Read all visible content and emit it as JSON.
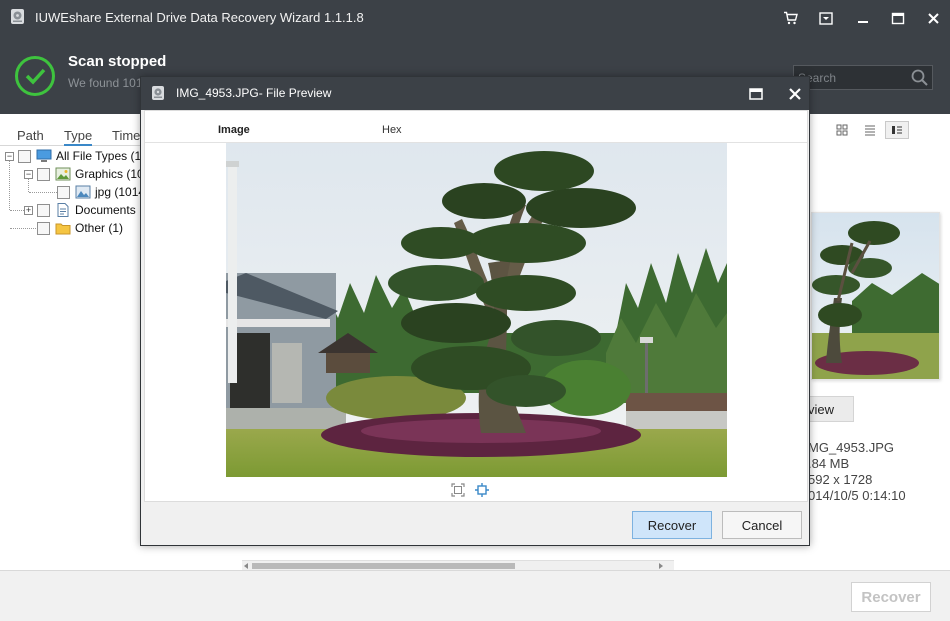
{
  "window": {
    "title": "IUWEshare External Drive Data Recovery Wizard 1.1.1.8",
    "icons": [
      "app-drive-icon",
      "cart-icon",
      "menu-dropdown-icon",
      "minimize-icon",
      "maximize-icon",
      "close-icon"
    ]
  },
  "status": {
    "title": "Scan stopped",
    "subtitle": "We found 101",
    "success_color": "#3ec33e"
  },
  "search": {
    "placeholder": "Search"
  },
  "left_tabs": [
    {
      "label": "Path",
      "active": false
    },
    {
      "label": "Type",
      "active": true
    },
    {
      "label": "Time",
      "active": false
    }
  ],
  "tree": {
    "root": "All File Types (10",
    "graphics": "Graphics (10",
    "jpg": "jpg (1014",
    "documents": "Documents",
    "other": "Other (1)"
  },
  "view_modes": [
    "thumbnail-view-icon",
    "list-view-icon",
    "detail-view-icon"
  ],
  "right_panel": {
    "preview_button": "view",
    "file_name": "MG_4953.JPG",
    "file_size": ".84 MB",
    "dimensions": "592 x 1728",
    "date": "014/10/5 0:14:10"
  },
  "footer": {
    "recover_label": "Recover"
  },
  "dialog": {
    "title": "IMG_4953.JPG- File Preview",
    "tabs": [
      {
        "label": "Image",
        "active": true
      },
      {
        "label": "Hex",
        "active": false
      }
    ],
    "recover_label": "Recover",
    "cancel_label": "Cancel",
    "accent": "#7db2e0"
  }
}
